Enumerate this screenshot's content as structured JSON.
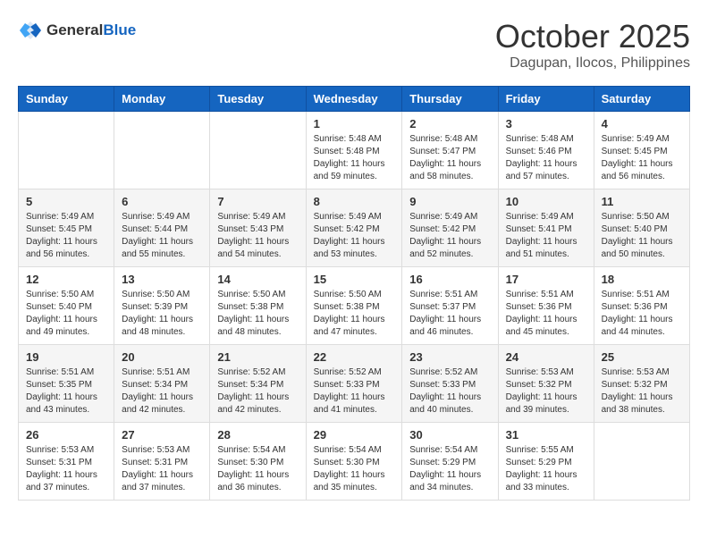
{
  "header": {
    "logo": {
      "line1": "General",
      "line2": "Blue"
    },
    "month": "October 2025",
    "location": "Dagupan, Ilocos, Philippines"
  },
  "weekdays": [
    "Sunday",
    "Monday",
    "Tuesday",
    "Wednesday",
    "Thursday",
    "Friday",
    "Saturday"
  ],
  "weeks": [
    [
      {
        "day": "",
        "info": ""
      },
      {
        "day": "",
        "info": ""
      },
      {
        "day": "",
        "info": ""
      },
      {
        "day": "1",
        "info": "Sunrise: 5:48 AM\nSunset: 5:48 PM\nDaylight: 11 hours\nand 59 minutes."
      },
      {
        "day": "2",
        "info": "Sunrise: 5:48 AM\nSunset: 5:47 PM\nDaylight: 11 hours\nand 58 minutes."
      },
      {
        "day": "3",
        "info": "Sunrise: 5:48 AM\nSunset: 5:46 PM\nDaylight: 11 hours\nand 57 minutes."
      },
      {
        "day": "4",
        "info": "Sunrise: 5:49 AM\nSunset: 5:45 PM\nDaylight: 11 hours\nand 56 minutes."
      }
    ],
    [
      {
        "day": "5",
        "info": "Sunrise: 5:49 AM\nSunset: 5:45 PM\nDaylight: 11 hours\nand 56 minutes."
      },
      {
        "day": "6",
        "info": "Sunrise: 5:49 AM\nSunset: 5:44 PM\nDaylight: 11 hours\nand 55 minutes."
      },
      {
        "day": "7",
        "info": "Sunrise: 5:49 AM\nSunset: 5:43 PM\nDaylight: 11 hours\nand 54 minutes."
      },
      {
        "day": "8",
        "info": "Sunrise: 5:49 AM\nSunset: 5:42 PM\nDaylight: 11 hours\nand 53 minutes."
      },
      {
        "day": "9",
        "info": "Sunrise: 5:49 AM\nSunset: 5:42 PM\nDaylight: 11 hours\nand 52 minutes."
      },
      {
        "day": "10",
        "info": "Sunrise: 5:49 AM\nSunset: 5:41 PM\nDaylight: 11 hours\nand 51 minutes."
      },
      {
        "day": "11",
        "info": "Sunrise: 5:50 AM\nSunset: 5:40 PM\nDaylight: 11 hours\nand 50 minutes."
      }
    ],
    [
      {
        "day": "12",
        "info": "Sunrise: 5:50 AM\nSunset: 5:40 PM\nDaylight: 11 hours\nand 49 minutes."
      },
      {
        "day": "13",
        "info": "Sunrise: 5:50 AM\nSunset: 5:39 PM\nDaylight: 11 hours\nand 48 minutes."
      },
      {
        "day": "14",
        "info": "Sunrise: 5:50 AM\nSunset: 5:38 PM\nDaylight: 11 hours\nand 48 minutes."
      },
      {
        "day": "15",
        "info": "Sunrise: 5:50 AM\nSunset: 5:38 PM\nDaylight: 11 hours\nand 47 minutes."
      },
      {
        "day": "16",
        "info": "Sunrise: 5:51 AM\nSunset: 5:37 PM\nDaylight: 11 hours\nand 46 minutes."
      },
      {
        "day": "17",
        "info": "Sunrise: 5:51 AM\nSunset: 5:36 PM\nDaylight: 11 hours\nand 45 minutes."
      },
      {
        "day": "18",
        "info": "Sunrise: 5:51 AM\nSunset: 5:36 PM\nDaylight: 11 hours\nand 44 minutes."
      }
    ],
    [
      {
        "day": "19",
        "info": "Sunrise: 5:51 AM\nSunset: 5:35 PM\nDaylight: 11 hours\nand 43 minutes."
      },
      {
        "day": "20",
        "info": "Sunrise: 5:51 AM\nSunset: 5:34 PM\nDaylight: 11 hours\nand 42 minutes."
      },
      {
        "day": "21",
        "info": "Sunrise: 5:52 AM\nSunset: 5:34 PM\nDaylight: 11 hours\nand 42 minutes."
      },
      {
        "day": "22",
        "info": "Sunrise: 5:52 AM\nSunset: 5:33 PM\nDaylight: 11 hours\nand 41 minutes."
      },
      {
        "day": "23",
        "info": "Sunrise: 5:52 AM\nSunset: 5:33 PM\nDaylight: 11 hours\nand 40 minutes."
      },
      {
        "day": "24",
        "info": "Sunrise: 5:53 AM\nSunset: 5:32 PM\nDaylight: 11 hours\nand 39 minutes."
      },
      {
        "day": "25",
        "info": "Sunrise: 5:53 AM\nSunset: 5:32 PM\nDaylight: 11 hours\nand 38 minutes."
      }
    ],
    [
      {
        "day": "26",
        "info": "Sunrise: 5:53 AM\nSunset: 5:31 PM\nDaylight: 11 hours\nand 37 minutes."
      },
      {
        "day": "27",
        "info": "Sunrise: 5:53 AM\nSunset: 5:31 PM\nDaylight: 11 hours\nand 37 minutes."
      },
      {
        "day": "28",
        "info": "Sunrise: 5:54 AM\nSunset: 5:30 PM\nDaylight: 11 hours\nand 36 minutes."
      },
      {
        "day": "29",
        "info": "Sunrise: 5:54 AM\nSunset: 5:30 PM\nDaylight: 11 hours\nand 35 minutes."
      },
      {
        "day": "30",
        "info": "Sunrise: 5:54 AM\nSunset: 5:29 PM\nDaylight: 11 hours\nand 34 minutes."
      },
      {
        "day": "31",
        "info": "Sunrise: 5:55 AM\nSunset: 5:29 PM\nDaylight: 11 hours\nand 33 minutes."
      },
      {
        "day": "",
        "info": ""
      }
    ]
  ]
}
